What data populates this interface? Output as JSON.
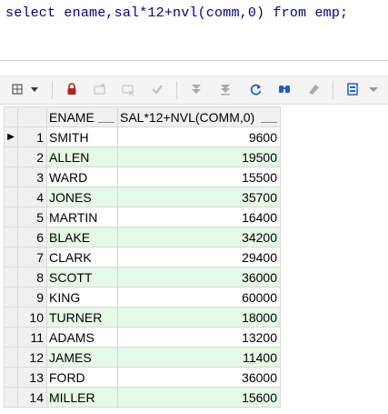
{
  "editor": {
    "sql": "select ename,sal*12+nvl(comm,0) from emp;"
  },
  "toolbar": {
    "icons": [
      "grid-menu-icon",
      "dropdown-arrow-icon",
      "lock-icon",
      "insert-row-icon",
      "delete-row-icon",
      "post-changes-icon",
      "fetch-next-icon",
      "fetch-last-icon",
      "refresh-icon",
      "find-icon",
      "clear-icon",
      "export-icon",
      "more-arrow-icon"
    ]
  },
  "grid": {
    "columns": [
      "ENAME",
      "SAL*12+NVL(COMM,0)"
    ],
    "rows": [
      {
        "n": "1",
        "ename": "SMITH",
        "val": "9600"
      },
      {
        "n": "2",
        "ename": "ALLEN",
        "val": "19500"
      },
      {
        "n": "3",
        "ename": "WARD",
        "val": "15500"
      },
      {
        "n": "4",
        "ename": "JONES",
        "val": "35700"
      },
      {
        "n": "5",
        "ename": "MARTIN",
        "val": "16400"
      },
      {
        "n": "6",
        "ename": "BLAKE",
        "val": "34200"
      },
      {
        "n": "7",
        "ename": "CLARK",
        "val": "29400"
      },
      {
        "n": "8",
        "ename": "SCOTT",
        "val": "36000"
      },
      {
        "n": "9",
        "ename": "KING",
        "val": "60000"
      },
      {
        "n": "10",
        "ename": "TURNER",
        "val": "18000"
      },
      {
        "n": "11",
        "ename": "ADAMS",
        "val": "13200"
      },
      {
        "n": "12",
        "ename": "JAMES",
        "val": "11400"
      },
      {
        "n": "13",
        "ename": "FORD",
        "val": "36000"
      },
      {
        "n": "14",
        "ename": "MILLER",
        "val": "15600"
      }
    ],
    "current_row_marker": "▶"
  },
  "colors": {
    "alt_row": "#e6f8e6",
    "sql_text": "#000080",
    "lock_red": "#b22222",
    "blue": "#1f5fbf"
  }
}
